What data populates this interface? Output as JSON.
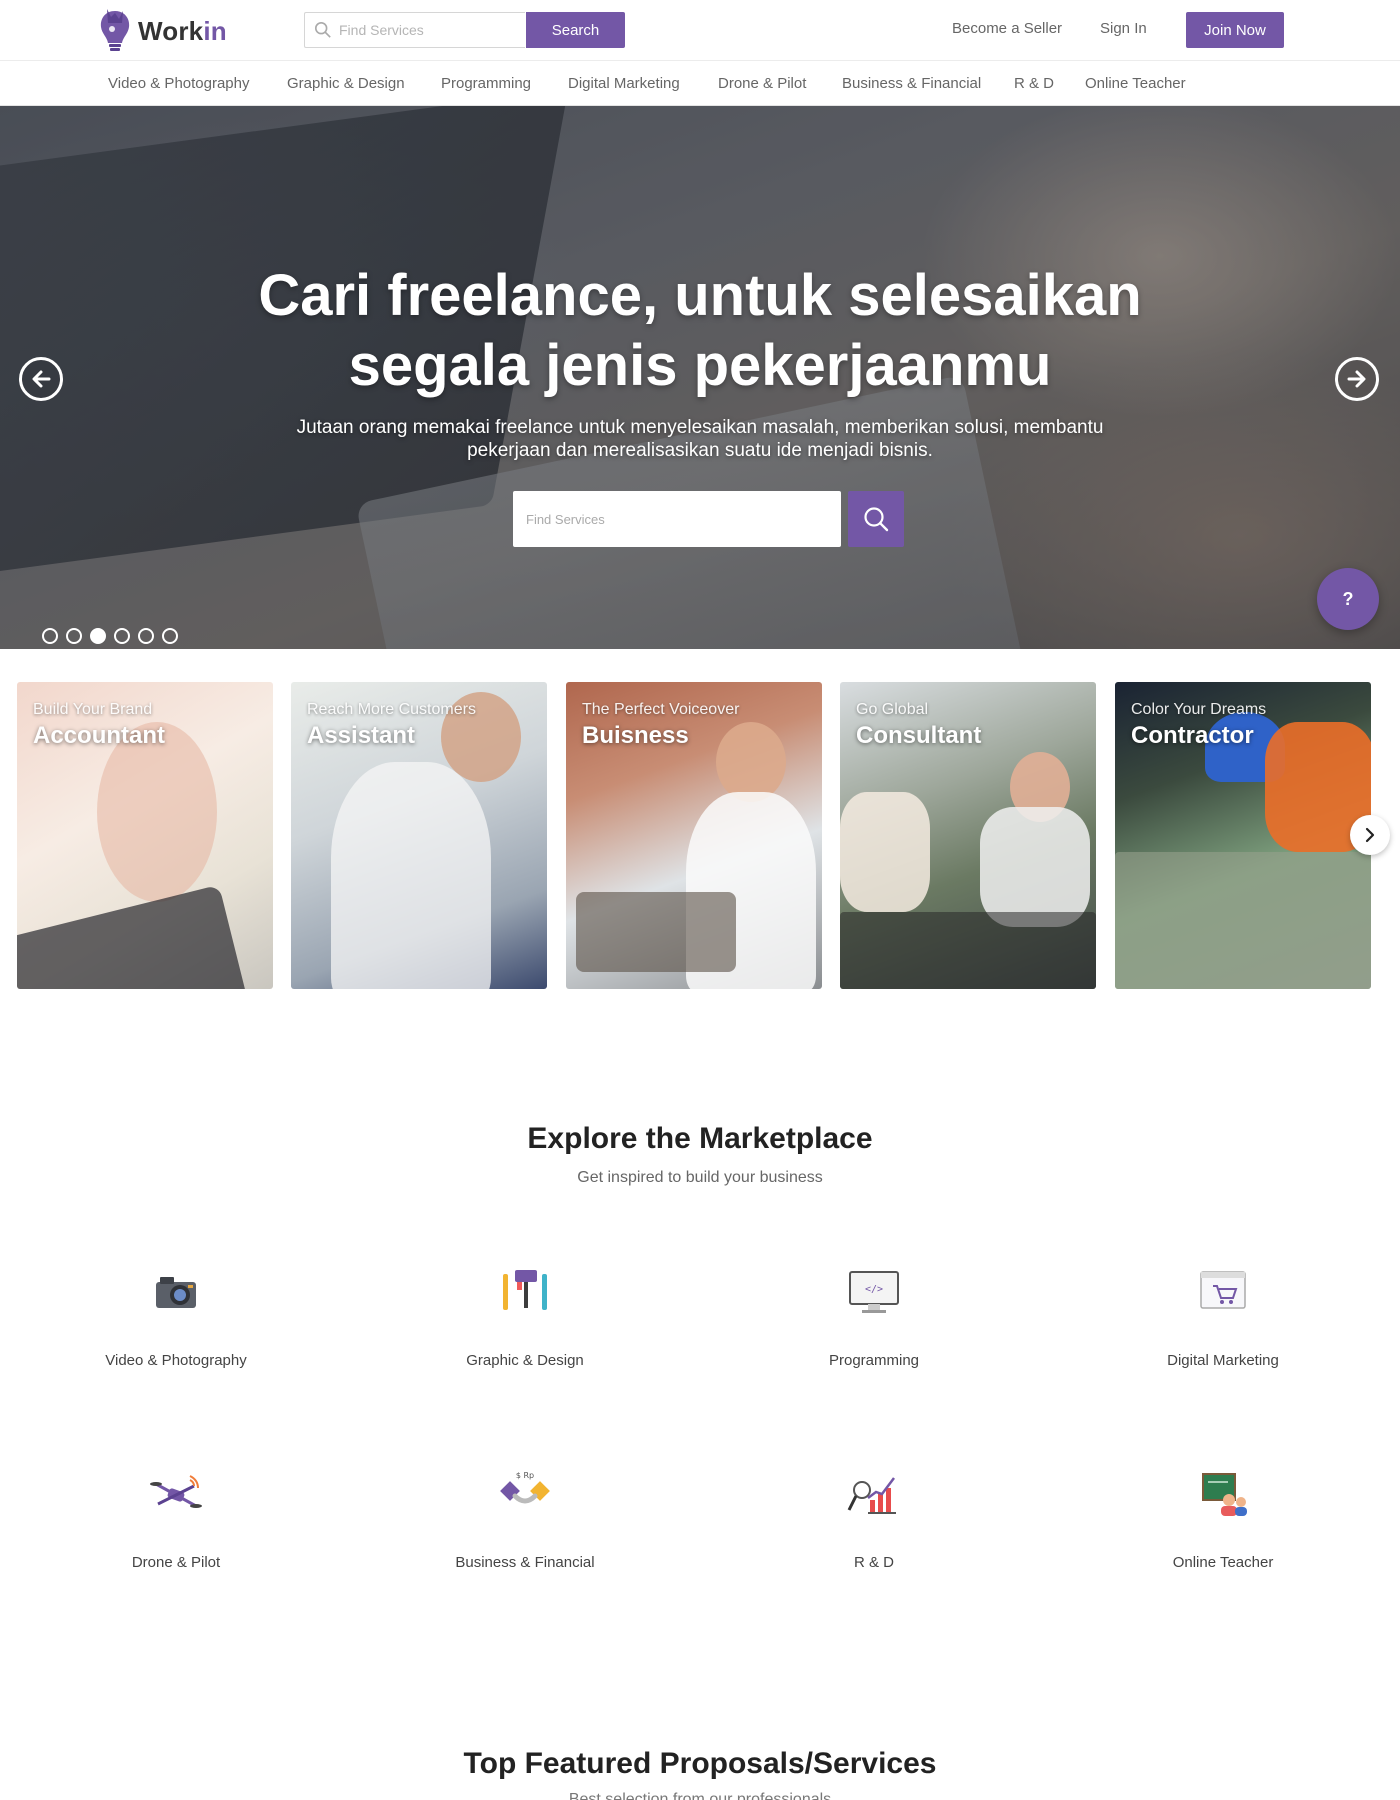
{
  "brand": {
    "name_main": "Work",
    "name_accent": "in",
    "accent_color": "#7357a6"
  },
  "header": {
    "search_placeholder": "Find Services",
    "search_button": "Search",
    "become_seller": "Become a Seller",
    "sign_in": "Sign In",
    "join_now": "Join Now"
  },
  "nav": {
    "categories": [
      "Video & Photography",
      "Graphic & Design",
      "Programming",
      "Digital Marketing",
      "Drone & Pilot",
      "Business & Financial",
      "R & D",
      "Online Teacher"
    ]
  },
  "hero": {
    "title_line1": "Cari freelance, untuk selesaikan",
    "title_line2": "segala jenis pekerjaanmu",
    "subtitle_line1": "Jutaan orang memakai freelance untuk menyelesaikan masalah, memberikan solusi, membantu",
    "subtitle_line2": "pekerjaan dan merealisasikan suatu ide menjadi bisnis.",
    "search_placeholder": "Find Services",
    "slide_count": 6,
    "active_slide": 3,
    "help_icon": "question-icon"
  },
  "cards": [
    {
      "tag": "Build Your Brand",
      "title": "Accountant"
    },
    {
      "tag": "Reach More Customers",
      "title": "Assistant"
    },
    {
      "tag": "The Perfect Voiceover",
      "title": "Buisness"
    },
    {
      "tag": "Go Global",
      "title": "Consultant"
    },
    {
      "tag": "Color Your Dreams",
      "title": "Contractor"
    }
  ],
  "explore": {
    "title": "Explore the Marketplace",
    "subtitle": "Get inspired to build your business",
    "categories": [
      {
        "label": "Video & Photography",
        "icon": "camera-icon"
      },
      {
        "label": "Graphic & Design",
        "icon": "paint-tools-icon"
      },
      {
        "label": "Programming",
        "icon": "code-monitor-icon"
      },
      {
        "label": "Digital Marketing",
        "icon": "shopping-cart-icon"
      },
      {
        "label": "Drone & Pilot",
        "icon": "drone-icon"
      },
      {
        "label": "Business & Financial",
        "icon": "handshake-icon"
      },
      {
        "label": "R & D",
        "icon": "growth-chart-icon"
      },
      {
        "label": "Online Teacher",
        "icon": "teacher-board-icon"
      }
    ]
  },
  "featured": {
    "title": "Top Featured Proposals/Services",
    "subtitle": "Best selection from our professionals"
  }
}
